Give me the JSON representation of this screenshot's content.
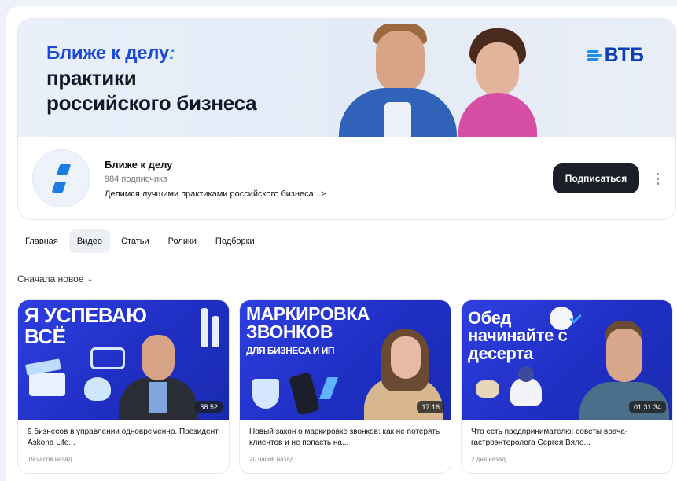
{
  "banner": {
    "title_accent": "Ближе к делу",
    "title_colon": ":",
    "line2": "практики",
    "line3": "российского бизнеса",
    "brand": "ВТБ"
  },
  "channel": {
    "name": "Ближе к делу",
    "subscribers": "984 подписчика",
    "description": "Делимся лучшими практиками российского бизнеса...>",
    "subscribe_label": "Подписаться"
  },
  "tabs": [
    {
      "label": "Главная",
      "active": false
    },
    {
      "label": "Видео",
      "active": true
    },
    {
      "label": "Статьи",
      "active": false
    },
    {
      "label": "Ролики",
      "active": false
    },
    {
      "label": "Подборки",
      "active": false
    }
  ],
  "sort": {
    "label": "Сначала новое",
    "icon": "chevron-down-icon"
  },
  "videos": [
    {
      "thumb_text": "Я УСПЕВАЮ ВСЁ",
      "duration": "58:52",
      "title": "9 бизнесов в управлении одновременно. Президент Askona Life...",
      "age": "19 часов назад"
    },
    {
      "thumb_text": "МАРКИРОВКА ЗВОНКОВ",
      "thumb_subtext": "ДЛЯ БИЗНЕСА И ИП",
      "duration": "17:16",
      "title": "Новый закон о маркировке звонков: как не потерять клиентов и не попасть на...",
      "age": "20 часов назад"
    },
    {
      "thumb_text": "Обед начинайте с десерта",
      "duration": "01:31:34",
      "title": "Что есть предпринимателю: советы врача-гастроэнтеролога Сергея Вяло...",
      "age": "2 дня назад"
    }
  ],
  "colors": {
    "accent_blue": "#1b4bd6",
    "thumb_blue": "#2e3fe0",
    "subscribe_bg": "#1a1e26"
  }
}
